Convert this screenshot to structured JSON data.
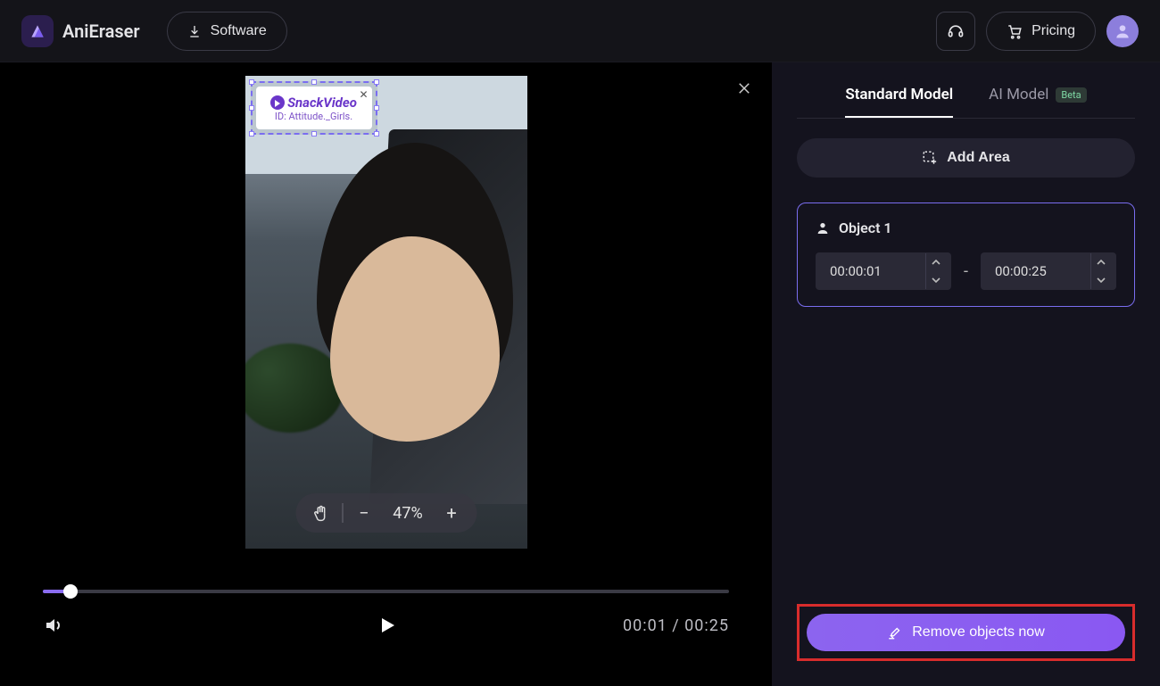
{
  "header": {
    "app_name": "AniEraser",
    "software_label": "Software",
    "pricing_label": "Pricing"
  },
  "preview": {
    "watermark_brand": "SnackVideo",
    "watermark_id": "ID: Attitude._Girls.",
    "zoom_percent": "47%"
  },
  "playback": {
    "current": "00:01",
    "duration": "00:25"
  },
  "side": {
    "tab_standard": "Standard Model",
    "tab_ai": "AI Model",
    "badge_beta": "Beta",
    "add_area": "Add Area",
    "object_title": "Object 1",
    "time_start": "00:00:01",
    "time_end": "00:00:25",
    "remove_label": "Remove objects now"
  }
}
